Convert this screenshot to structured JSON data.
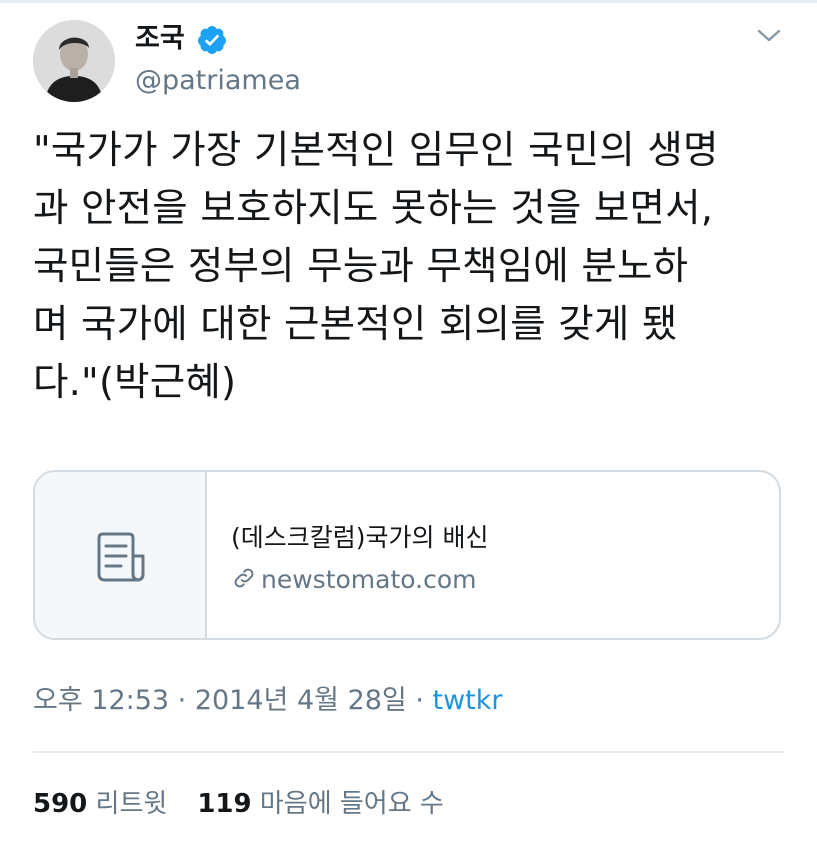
{
  "author": {
    "display_name": "조국",
    "handle": "@patriamea",
    "verified": true
  },
  "tweet": {
    "text": "\"국가가 가장 기본적인 임무인 국민의 생명\n과 안전을 보호하지도 못하는 것을 보면서,\n국민들은 정부의 무능과 무책임에 분노하\n며 국가에 대한 근본적인 회의를 갖게 됐\n다.\"(박근혜)"
  },
  "link_card": {
    "title": "(데스크칼럼)국가의 배신",
    "domain": "newstomato.com",
    "icon": "document-icon"
  },
  "meta": {
    "time": "오후 12:53",
    "sep1": " · ",
    "date": "2014년 4월 28일",
    "sep2": " · ",
    "source": "twtkr"
  },
  "stats": {
    "retweets_count": "590",
    "retweets_label": "리트윗",
    "likes_count": "119",
    "likes_label": "마음에 들어요 수"
  },
  "colors": {
    "verified_blue": "#1da1f2",
    "secondary_text": "#657786",
    "link_blue": "#1b95e0"
  }
}
